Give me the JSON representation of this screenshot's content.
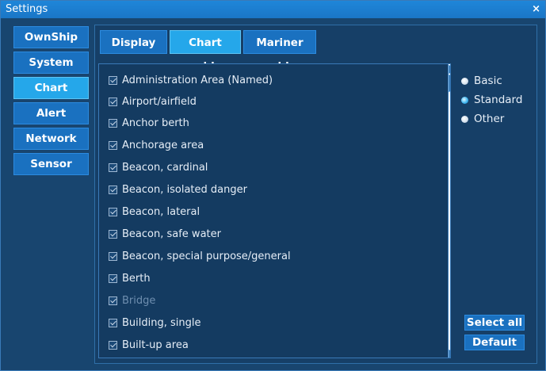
{
  "window": {
    "title": "Settings",
    "close_glyph": "×"
  },
  "nav": {
    "items": [
      {
        "label": "OwnShip",
        "active": false
      },
      {
        "label": "System",
        "active": false
      },
      {
        "label": "Chart",
        "active": true
      },
      {
        "label": "Alert",
        "active": false
      },
      {
        "label": "Network",
        "active": false
      },
      {
        "label": "Sensor",
        "active": false
      }
    ]
  },
  "tabs": {
    "display": "Display",
    "chart_obj": "Chart obj",
    "mariner_obj": "Mariner obj",
    "active": "chart_obj"
  },
  "list": {
    "items": [
      {
        "label": "Administration Area (Named)",
        "checked": true,
        "disabled": false
      },
      {
        "label": "Airport/airfield",
        "checked": true,
        "disabled": false
      },
      {
        "label": "Anchor berth",
        "checked": true,
        "disabled": false
      },
      {
        "label": "Anchorage area",
        "checked": true,
        "disabled": false
      },
      {
        "label": "Beacon, cardinal",
        "checked": true,
        "disabled": false
      },
      {
        "label": "Beacon, isolated danger",
        "checked": true,
        "disabled": false
      },
      {
        "label": "Beacon, lateral",
        "checked": true,
        "disabled": false
      },
      {
        "label": "Beacon, safe water",
        "checked": true,
        "disabled": false
      },
      {
        "label": "Beacon, special purpose/general",
        "checked": true,
        "disabled": false
      },
      {
        "label": "Berth",
        "checked": true,
        "disabled": false
      },
      {
        "label": "Bridge",
        "checked": true,
        "disabled": true
      },
      {
        "label": "Building, single",
        "checked": true,
        "disabled": false
      },
      {
        "label": "Built-up area",
        "checked": true,
        "disabled": false
      }
    ]
  },
  "display_category": {
    "options": [
      {
        "label": "Basic",
        "selected": false
      },
      {
        "label": "Standard",
        "selected": true
      },
      {
        "label": "Other",
        "selected": false
      }
    ]
  },
  "buttons": {
    "select_all": "Select all",
    "default": "Default"
  }
}
